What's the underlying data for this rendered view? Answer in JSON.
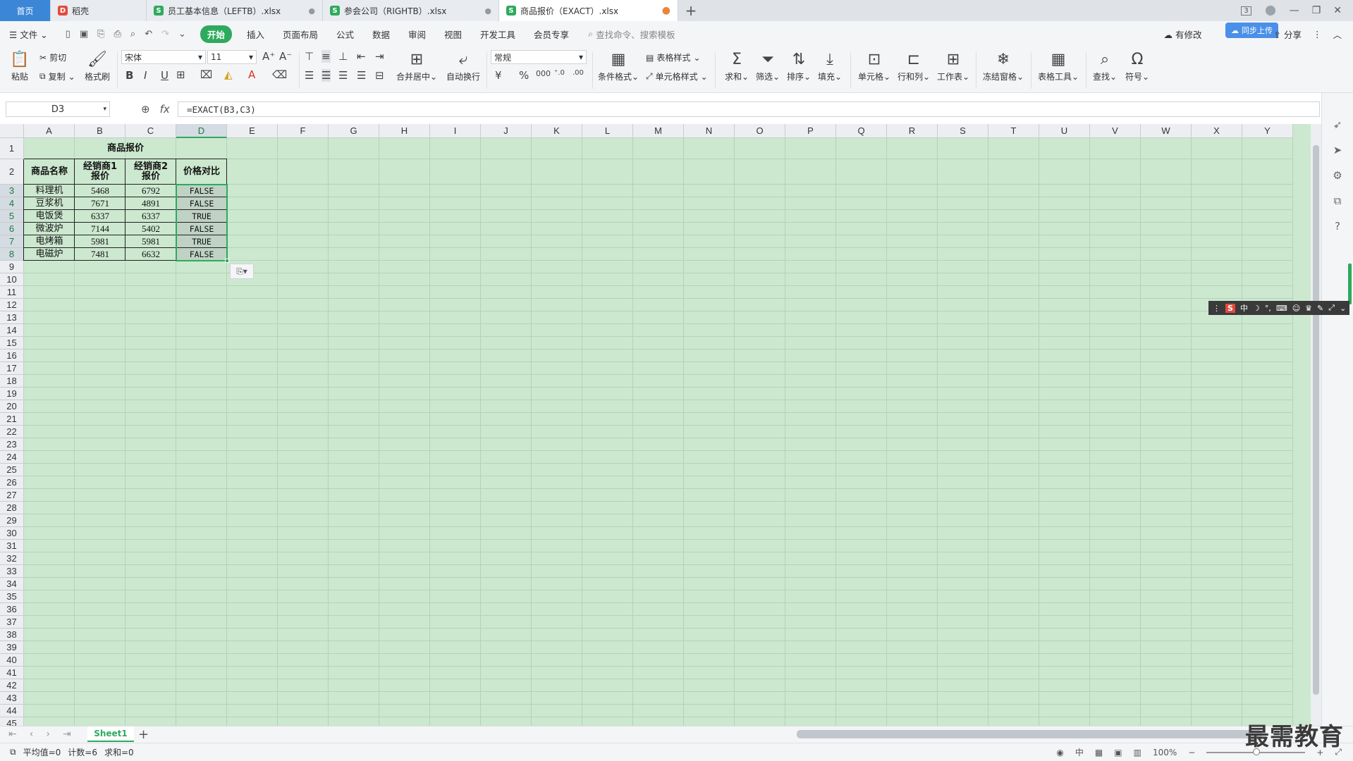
{
  "tabs": {
    "home": "首页",
    "daoke": "稻壳",
    "doc1": "员工基本信息（LEFTB）.xlsx",
    "doc2": "参会公司（RIGHTB）.xlsx",
    "doc3": "商品报价（EXACT）.xlsx",
    "new_tab": "+",
    "badge_count": "3"
  },
  "menu": {
    "file": "文件",
    "items": [
      "开始",
      "插入",
      "页面布局",
      "公式",
      "数据",
      "审阅",
      "视图",
      "开发工具",
      "会员专享"
    ],
    "search_placeholder": "查找命令、搜索模板",
    "cloud_label": "有修改",
    "sync_label": "同步上传",
    "share": "分享"
  },
  "ribbon": {
    "paste": "粘贴",
    "cut": "剪切",
    "copy": "复制",
    "format_painter": "格式刷",
    "font_name": "宋体",
    "font_size": "11",
    "merge_center": "合并居中",
    "wrap_text": "自动换行",
    "number_format": "常规",
    "cond_format": "条件格式",
    "table_style": "表格样式",
    "cell_style": "单元格样式",
    "sum": "求和",
    "filter": "筛选",
    "sort": "排序",
    "fill": "填充",
    "cell": "单元格",
    "row_col": "行和列",
    "worksheet": "工作表",
    "freeze": "冻结窗格",
    "table_tools": "表格工具",
    "find": "查找",
    "symbol": "符号"
  },
  "formula_bar": {
    "name_box": "D3",
    "fx": "fx",
    "formula": "=EXACT(B3,C3)"
  },
  "columns": [
    "A",
    "B",
    "C",
    "D",
    "E",
    "F",
    "G",
    "H",
    "I",
    "J",
    "K",
    "L",
    "M",
    "N",
    "O",
    "P",
    "Q",
    "R",
    "S",
    "T",
    "U",
    "V",
    "W",
    "X",
    "Y"
  ],
  "rows_visible": 45,
  "table": {
    "title": "商品报价",
    "headers": [
      {
        "line1": "商品名称",
        "line2": ""
      },
      {
        "line1": "经销商1",
        "line2": "报价"
      },
      {
        "line1": "经销商2",
        "line2": "报价"
      },
      {
        "line1": "价格对比",
        "line2": ""
      }
    ],
    "rows": [
      {
        "name": "料理机",
        "p1": "5468",
        "p2": "6792",
        "cmp": "FALSE"
      },
      {
        "name": "豆浆机",
        "p1": "7671",
        "p2": "4891",
        "cmp": "FALSE"
      },
      {
        "name": "电饭煲",
        "p1": "6337",
        "p2": "6337",
        "cmp": "TRUE"
      },
      {
        "name": "微波炉",
        "p1": "7144",
        "p2": "5402",
        "cmp": "FALSE"
      },
      {
        "name": "电烤箱",
        "p1": "5981",
        "p2": "5981",
        "cmp": "TRUE"
      },
      {
        "name": "电磁炉",
        "p1": "7481",
        "p2": "6632",
        "cmp": "FALSE"
      }
    ]
  },
  "sheets": {
    "active": "Sheet1"
  },
  "status": {
    "average": "平均值=0",
    "count": "计数=6",
    "sum": "求和=0",
    "ime_mode": "中",
    "zoom": "100%"
  },
  "ime_bar": {
    "logo": "S",
    "mode": "中"
  },
  "watermark": "最需教育",
  "colors": {
    "accent": "#2eaa5e",
    "grid_bg": "#cce8cf",
    "home_tab": "#3c86d8"
  }
}
